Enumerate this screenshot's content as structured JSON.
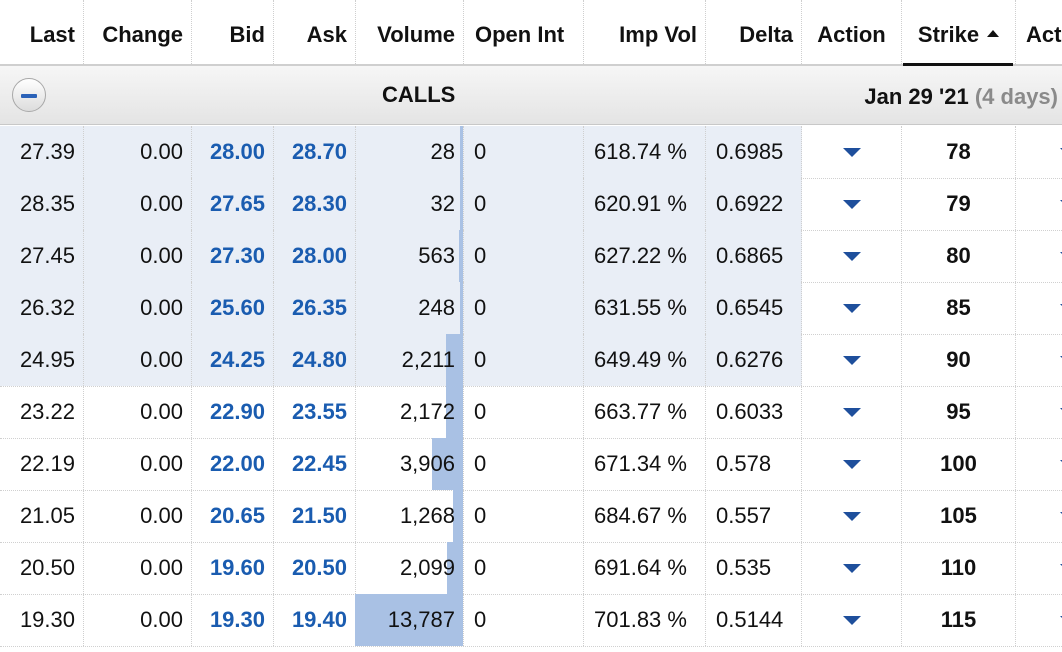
{
  "header": {
    "last": "Last",
    "change": "Change",
    "bid": "Bid",
    "ask": "Ask",
    "volume": "Volume",
    "open_int": "Open Int",
    "imp_vol": "Imp Vol",
    "delta": "Delta",
    "action": "Action",
    "strike": "Strike",
    "action2": "Act"
  },
  "group": {
    "label": "CALLS",
    "date": "Jan 29 '21",
    "days": "(4 days)"
  },
  "rows": [
    {
      "last": "27.39",
      "change": "0.00",
      "bid": "28.00",
      "ask": "28.70",
      "volume": "28",
      "volume_frac": 0.002,
      "open_int": "0",
      "imp_vol": "618.74 %",
      "delta": "0.6985",
      "strike": "78",
      "shaded": true
    },
    {
      "last": "28.35",
      "change": "0.00",
      "bid": "27.65",
      "ask": "28.30",
      "volume": "32",
      "volume_frac": 0.002,
      "open_int": "0",
      "imp_vol": "620.91 %",
      "delta": "0.6922",
      "strike": "79",
      "shaded": true
    },
    {
      "last": "27.45",
      "change": "0.00",
      "bid": "27.30",
      "ask": "28.00",
      "volume": "563",
      "volume_frac": 0.04,
      "open_int": "0",
      "imp_vol": "627.22 %",
      "delta": "0.6865",
      "strike": "80",
      "shaded": true
    },
    {
      "last": "26.32",
      "change": "0.00",
      "bid": "25.60",
      "ask": "26.35",
      "volume": "248",
      "volume_frac": 0.018,
      "open_int": "0",
      "imp_vol": "631.55 %",
      "delta": "0.6545",
      "strike": "85",
      "shaded": true
    },
    {
      "last": "24.95",
      "change": "0.00",
      "bid": "24.25",
      "ask": "24.80",
      "volume": "2,211",
      "volume_frac": 0.16,
      "open_int": "0",
      "imp_vol": "649.49 %",
      "delta": "0.6276",
      "strike": "90",
      "shaded": true
    },
    {
      "last": "23.22",
      "change": "0.00",
      "bid": "22.90",
      "ask": "23.55",
      "volume": "2,172",
      "volume_frac": 0.158,
      "open_int": "0",
      "imp_vol": "663.77 %",
      "delta": "0.6033",
      "strike": "95",
      "shaded": false
    },
    {
      "last": "22.19",
      "change": "0.00",
      "bid": "22.00",
      "ask": "22.45",
      "volume": "3,906",
      "volume_frac": 0.283,
      "open_int": "0",
      "imp_vol": "671.34 %",
      "delta": "0.578",
      "strike": "100",
      "shaded": false
    },
    {
      "last": "21.05",
      "change": "0.00",
      "bid": "20.65",
      "ask": "21.50",
      "volume": "1,268",
      "volume_frac": 0.092,
      "open_int": "0",
      "imp_vol": "684.67 %",
      "delta": "0.557",
      "strike": "105",
      "shaded": false
    },
    {
      "last": "20.50",
      "change": "0.00",
      "bid": "19.60",
      "ask": "20.50",
      "volume": "2,099",
      "volume_frac": 0.152,
      "open_int": "0",
      "imp_vol": "691.64 %",
      "delta": "0.535",
      "strike": "110",
      "shaded": false
    },
    {
      "last": "19.30",
      "change": "0.00",
      "bid": "19.30",
      "ask": "19.40",
      "volume": "13,787",
      "volume_frac": 1.0,
      "open_int": "0",
      "imp_vol": "701.83 %",
      "delta": "0.5144",
      "strike": "115",
      "shaded": false
    }
  ]
}
